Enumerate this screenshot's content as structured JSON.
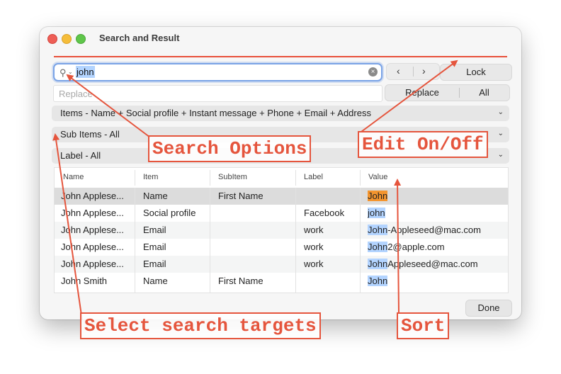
{
  "window": {
    "title": "Search and Result"
  },
  "search": {
    "value": "john"
  },
  "nav": {
    "prev": "‹",
    "next": "›"
  },
  "lock_label": "Lock",
  "replace": {
    "placeholder": "Replace",
    "replace_label": "Replace",
    "all_label": "All"
  },
  "popups": {
    "items": "Items - Name + Social profile + Instant message + Phone + Email + Address",
    "sub_items": "Sub Items - All",
    "label": "Label - All"
  },
  "table": {
    "headers": [
      "Name",
      "Item",
      "SubItem",
      "Label",
      "Value"
    ],
    "rows": [
      {
        "name": "John Applese...",
        "item": "Name",
        "subitem": "First Name",
        "label": "",
        "match": "John",
        "rest": ""
      },
      {
        "name": "John Applese...",
        "item": "Social profile",
        "subitem": "",
        "label": "Facebook",
        "match": "john",
        "rest": ""
      },
      {
        "name": "John Applese...",
        "item": "Email",
        "subitem": "",
        "label": "work",
        "match": "John",
        "rest": "-Appleseed@mac.com"
      },
      {
        "name": "John Applese...",
        "item": "Email",
        "subitem": "",
        "label": "work",
        "match": "John",
        "rest": "2@apple.com"
      },
      {
        "name": "John Applese...",
        "item": "Email",
        "subitem": "",
        "label": "work",
        "match": "John",
        "rest": "Appleseed@mac.com"
      },
      {
        "name": "John Smith",
        "item": "Name",
        "subitem": "First Name",
        "label": "",
        "match": "John",
        "rest": ""
      }
    ]
  },
  "done_label": "Done",
  "annotations": {
    "search_options": "Search Options",
    "edit_onoff": "Edit On/Off",
    "select_targets": "Select search targets",
    "sort": "Sort"
  },
  "colors": {
    "annotation": "#e5553d",
    "match_highlight": "#b3d4ff",
    "current_match": "#f4952f",
    "focus_ring": "#7aa3e6"
  }
}
